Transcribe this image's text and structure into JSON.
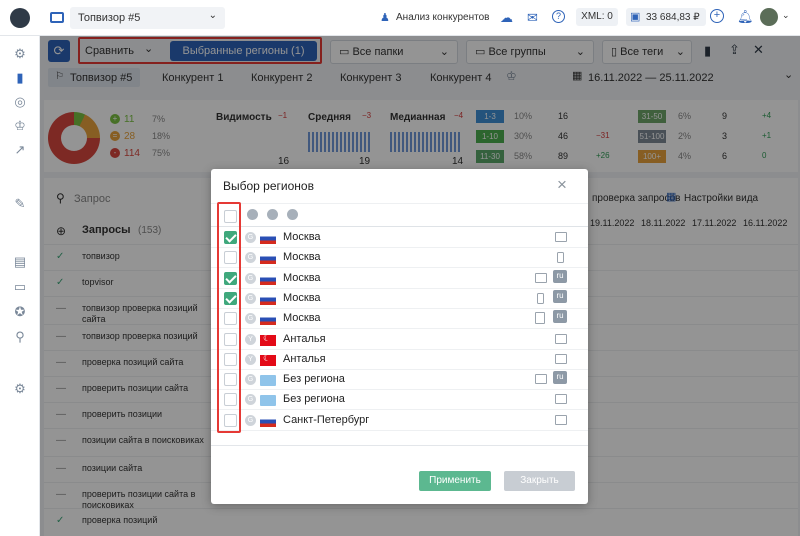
{
  "topbar": {
    "project": "Топвизор #5",
    "competitor_analysis": "Анализ конкурентов",
    "xml_label": "XML: 0",
    "balance": "33 684,83 ₽"
  },
  "toolbar": {
    "compare": "Сравнить",
    "selected_regions": "Выбранные регионы  (1)",
    "folders": "Все папки",
    "groups": "Все группы",
    "tags": "Все теги"
  },
  "tabs": [
    "Топвизор #5",
    "Конкурент 1",
    "Конкурент 2",
    "Конкурент 3",
    "Конкурент 4"
  ],
  "date_range": "16.11.2022 — 25.11.2022",
  "summary": {
    "pie": [
      {
        "icon": "+",
        "count": "11",
        "pct": "7%",
        "color": "#7ac142"
      },
      {
        "icon": "=",
        "count": "28",
        "pct": "18%",
        "color": "#e8a33d"
      },
      {
        "icon": "-",
        "count": "114",
        "pct": "75%",
        "color": "#d7473f"
      }
    ],
    "visibility_label": "Видимость",
    "visibility_delta": "−1",
    "visibility_val": "16",
    "avg_label": "Средняя",
    "avg_delta": "−3",
    "avg_val": "19",
    "median_label": "Медианная",
    "median_delta": "−4",
    "median_val": "14",
    "ranges_left": [
      {
        "r": "1-3",
        "pct": "10%",
        "v": "16",
        "d": ""
      },
      {
        "r": "1-10",
        "pct": "30%",
        "v": "46",
        "d": "−31"
      },
      {
        "r": "11-30",
        "pct": "58%",
        "v": "89",
        "d": "+26"
      }
    ],
    "ranges_right": [
      {
        "r": "31-50",
        "pct": "6%",
        "v": "9",
        "d": "+4"
      },
      {
        "r": "51-100",
        "pct": "2%",
        "v": "3",
        "d": "+1"
      },
      {
        "r": "100+",
        "pct": "4%",
        "v": "6",
        "d": "0"
      }
    ]
  },
  "table": {
    "search_placeholder": "Запрос",
    "queries_label": "Запросы",
    "queries_count": "(153)",
    "settings_label": "Настройки вида",
    "check_label": "проверка запросов",
    "dates": [
      "19.11.2022",
      "18.11.2022",
      "17.11.2022",
      "16.11.2022"
    ],
    "rows": [
      "топвизор",
      "topvisor",
      "топвизор проверка позиций сайта",
      "топвизор проверка позиций",
      "проверка позиций сайта",
      "проверить позиции сайта",
      "проверить позиции",
      "позиции сайта в поисковиках",
      "позиции сайта",
      "проверить позиции сайта в поисковиках",
      "проверка позиций"
    ]
  },
  "modal": {
    "title": "Выбор регионов",
    "apply": "Применить",
    "close": "Закрыть",
    "regions": [
      {
        "name": "Москва",
        "checked": true,
        "flag": "ru",
        "device": "desktop",
        "lang": ""
      },
      {
        "name": "Москва",
        "checked": false,
        "flag": "ru",
        "device": "mobile",
        "lang": ""
      },
      {
        "name": "Москва",
        "checked": true,
        "flag": "ru",
        "device": "desktop",
        "lang": "ru"
      },
      {
        "name": "Москва",
        "checked": true,
        "flag": "ru",
        "device": "mobile",
        "lang": "ru"
      },
      {
        "name": "Москва",
        "checked": false,
        "flag": "ru",
        "device": "tablet",
        "lang": "ru"
      },
      {
        "name": "Анталья",
        "checked": false,
        "flag": "tr",
        "device": "desktop",
        "lang": ""
      },
      {
        "name": "Анталья",
        "checked": false,
        "flag": "tr",
        "device": "desktop",
        "lang": ""
      },
      {
        "name": "Без региона",
        "checked": false,
        "flag": "globe",
        "device": "desktop",
        "lang": "ru"
      },
      {
        "name": "Без региона",
        "checked": false,
        "flag": "globe",
        "device": "desktop",
        "lang": ""
      },
      {
        "name": "Санкт-Петербург",
        "checked": false,
        "flag": "ru",
        "device": "desktop",
        "lang": ""
      }
    ]
  },
  "colors": {
    "accent": "#2e63b8",
    "highlight": "#e53935",
    "success": "#3fa87c"
  }
}
